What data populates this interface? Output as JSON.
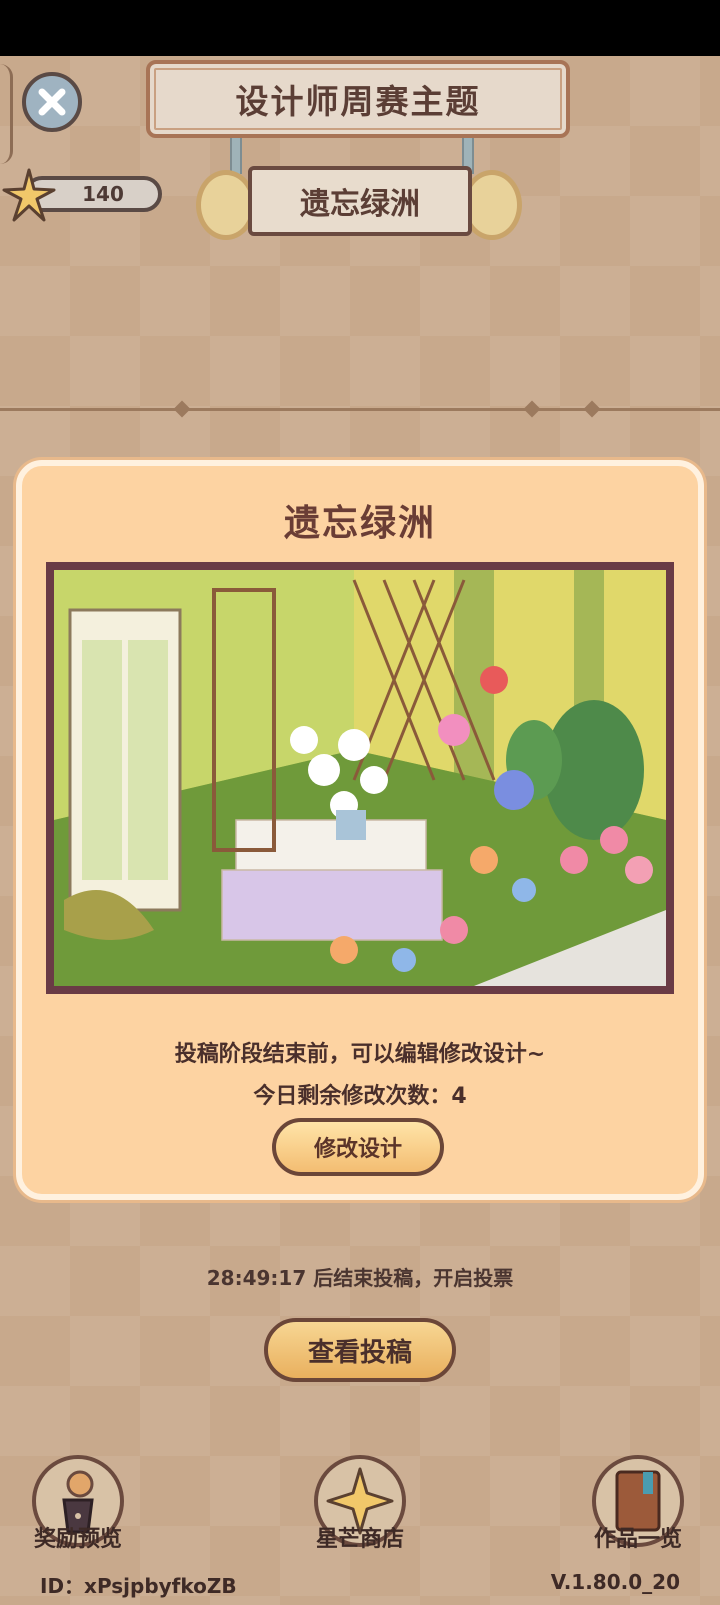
{
  "header": {
    "title": "设计师周赛主题",
    "theme": "遗忘绿洲",
    "star_count": "140"
  },
  "modal": {
    "title": "遗忘绿洲",
    "info_line1": "投稿阶段结束前，可以编辑修改设计~",
    "info_line2": "今日剩余修改次数：4",
    "edit_button": "修改设计"
  },
  "countdown": "28:49:17 后结束投稿，开启投票",
  "view_button": "查看投稿",
  "bottom_nav": [
    {
      "label": "奖励预览",
      "icon": "trophy-snail-icon"
    },
    {
      "label": "星芒商店",
      "icon": "star-icon"
    },
    {
      "label": "作品一览",
      "icon": "book-icon"
    }
  ],
  "footer": {
    "id_text": "ID：xPsjpbyfkoZB",
    "version": "V.1.80.0_20"
  }
}
